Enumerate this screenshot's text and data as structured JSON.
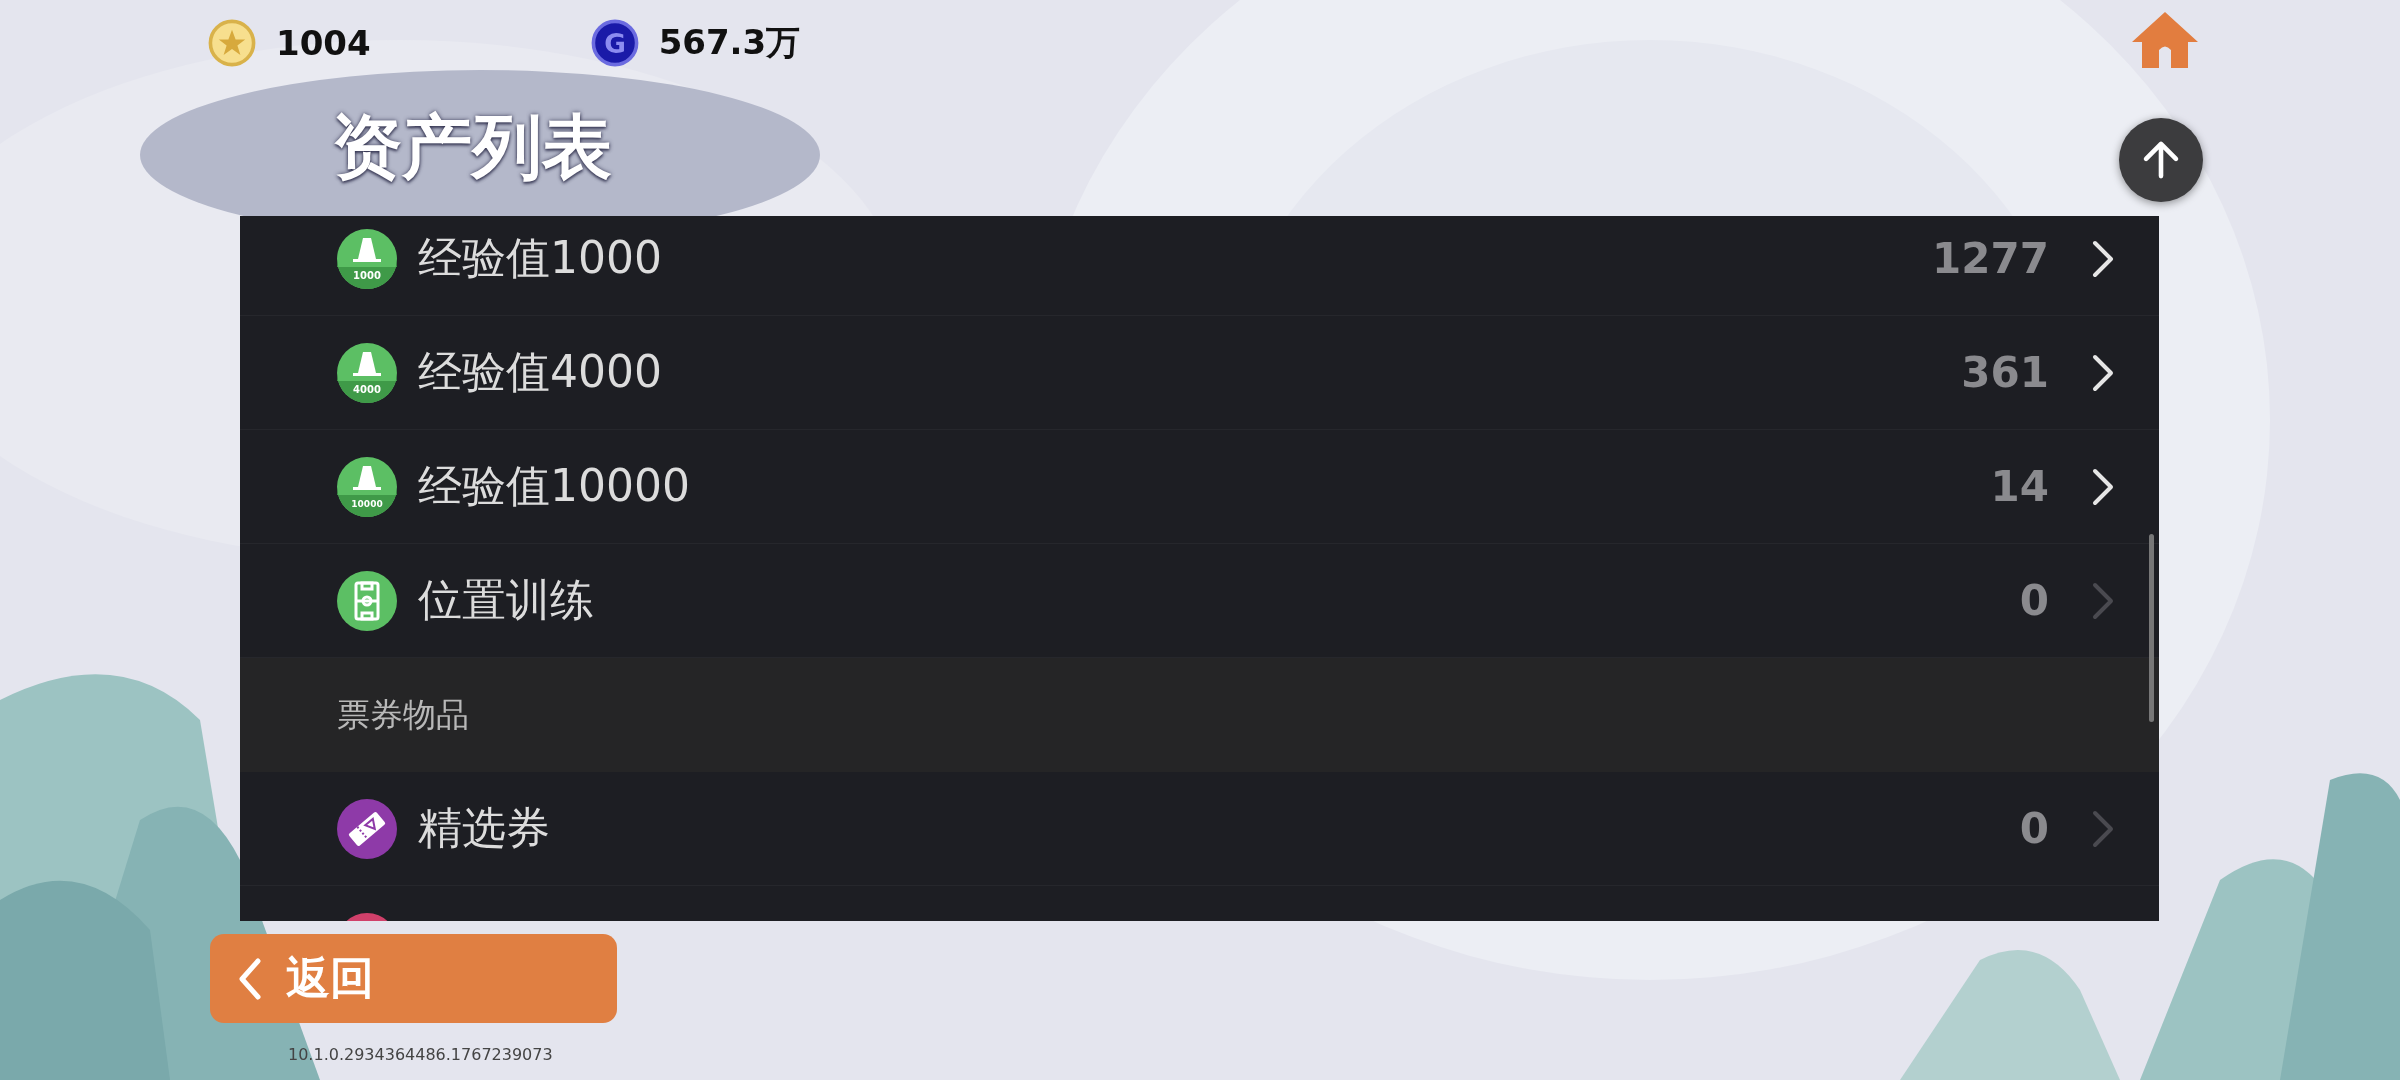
{
  "currencies": [
    {
      "kind": "star",
      "amount": "1004"
    },
    {
      "kind": "letter",
      "symbol": "G",
      "amount": "567.3万"
    }
  ],
  "title": "资产列表",
  "items": [
    {
      "kind": "cone",
      "badge": "1000",
      "label": "经验值1000",
      "count": "1277",
      "disabled": false,
      "color": "#5cbf64"
    },
    {
      "kind": "cone",
      "badge": "4000",
      "label": "经验值4000",
      "count": "361",
      "disabled": false,
      "color": "#5cbf64"
    },
    {
      "kind": "cone",
      "badge": "10000",
      "label": "经验值10000",
      "count": "14",
      "disabled": false,
      "color": "#5cbf64"
    },
    {
      "kind": "pitch",
      "label": "位置训练",
      "count": "0",
      "disabled": true,
      "color": "#5cbf64"
    },
    {
      "kind": "section",
      "label": "票券物品"
    },
    {
      "kind": "ticket",
      "label": "精选券",
      "count": "0",
      "disabled": true,
      "color": "#8e3aa8"
    },
    {
      "kind": "partial",
      "color": "#d0406a"
    }
  ],
  "back_button": {
    "label": "返回"
  },
  "version": "10.1.0.2934364486.1767239073"
}
